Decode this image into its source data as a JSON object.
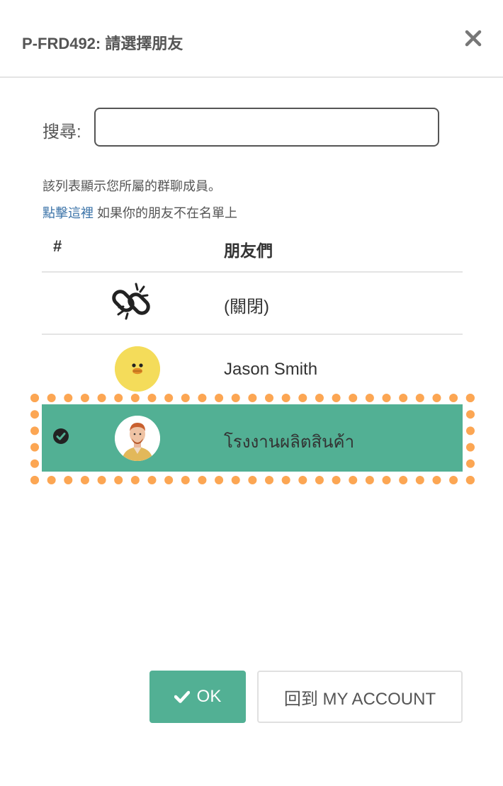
{
  "dialog": {
    "title": "P-FRD492: 請選擇朋友",
    "close_icon": "close-icon"
  },
  "search": {
    "label": "搜尋:",
    "value": "",
    "placeholder": ""
  },
  "info": {
    "line1": "該列表顯示您所屬的群聊成員。",
    "link_text": "點擊這裡",
    "line2_rest": " 如果你的朋友不在名單上"
  },
  "table": {
    "headers": [
      "#",
      "朋友們"
    ],
    "rows": [
      {
        "icon": "broken-link-icon",
        "name": "(關閉)",
        "selected": false
      },
      {
        "icon": "duck-avatar",
        "name": "Jason Smith",
        "selected": false
      },
      {
        "icon": "man-avatar",
        "name": "โรงงานผลิตสินค้า",
        "selected": true,
        "check_icon": "check-circle-icon"
      }
    ]
  },
  "buttons": {
    "ok_label": "OK",
    "ok_icon": "checkmark-icon",
    "back_label": "回到 MY ACCOUNT"
  },
  "colors": {
    "accent": "#52b094",
    "link": "#3b73a8",
    "highlight_frame": "#fca653"
  }
}
